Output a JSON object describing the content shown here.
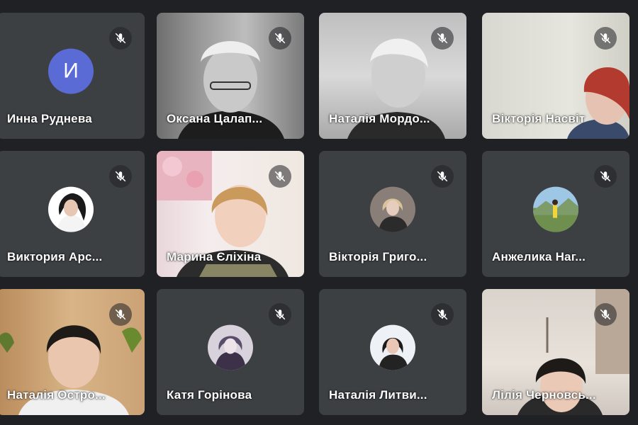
{
  "participants": [
    {
      "name": "Инна Руднева",
      "avatar_letter": "И",
      "tile_type": "avatar-letter",
      "muted": true
    },
    {
      "name": "Оксана Цалап...",
      "tile_type": "video",
      "muted": true
    },
    {
      "name": "Наталія Мордо...",
      "tile_type": "video",
      "muted": true
    },
    {
      "name": "Вікторія Насвіт",
      "tile_type": "video",
      "muted": true
    },
    {
      "name": "Виктория Арс...",
      "tile_type": "avatar-photo",
      "muted": true
    },
    {
      "name": "Марина Єліхіна",
      "tile_type": "video",
      "muted": true
    },
    {
      "name": "Вікторія Григо...",
      "tile_type": "avatar-photo",
      "muted": true
    },
    {
      "name": "Анжелика Наг...",
      "tile_type": "avatar-photo",
      "muted": true
    },
    {
      "name": "Наталія Остро...",
      "tile_type": "video",
      "muted": true
    },
    {
      "name": "Катя Горінова",
      "tile_type": "avatar-photo",
      "muted": true
    },
    {
      "name": "Наталія Литви...",
      "tile_type": "avatar-photo",
      "muted": true
    },
    {
      "name": "Лілія Черновсь...",
      "tile_type": "video",
      "muted": true
    }
  ],
  "colors": {
    "background": "#202124",
    "tile": "#3c4043",
    "letter_avatar": "#5b6bd6",
    "text": "#ffffff"
  },
  "icons": {
    "mute": "mic-off-icon"
  }
}
